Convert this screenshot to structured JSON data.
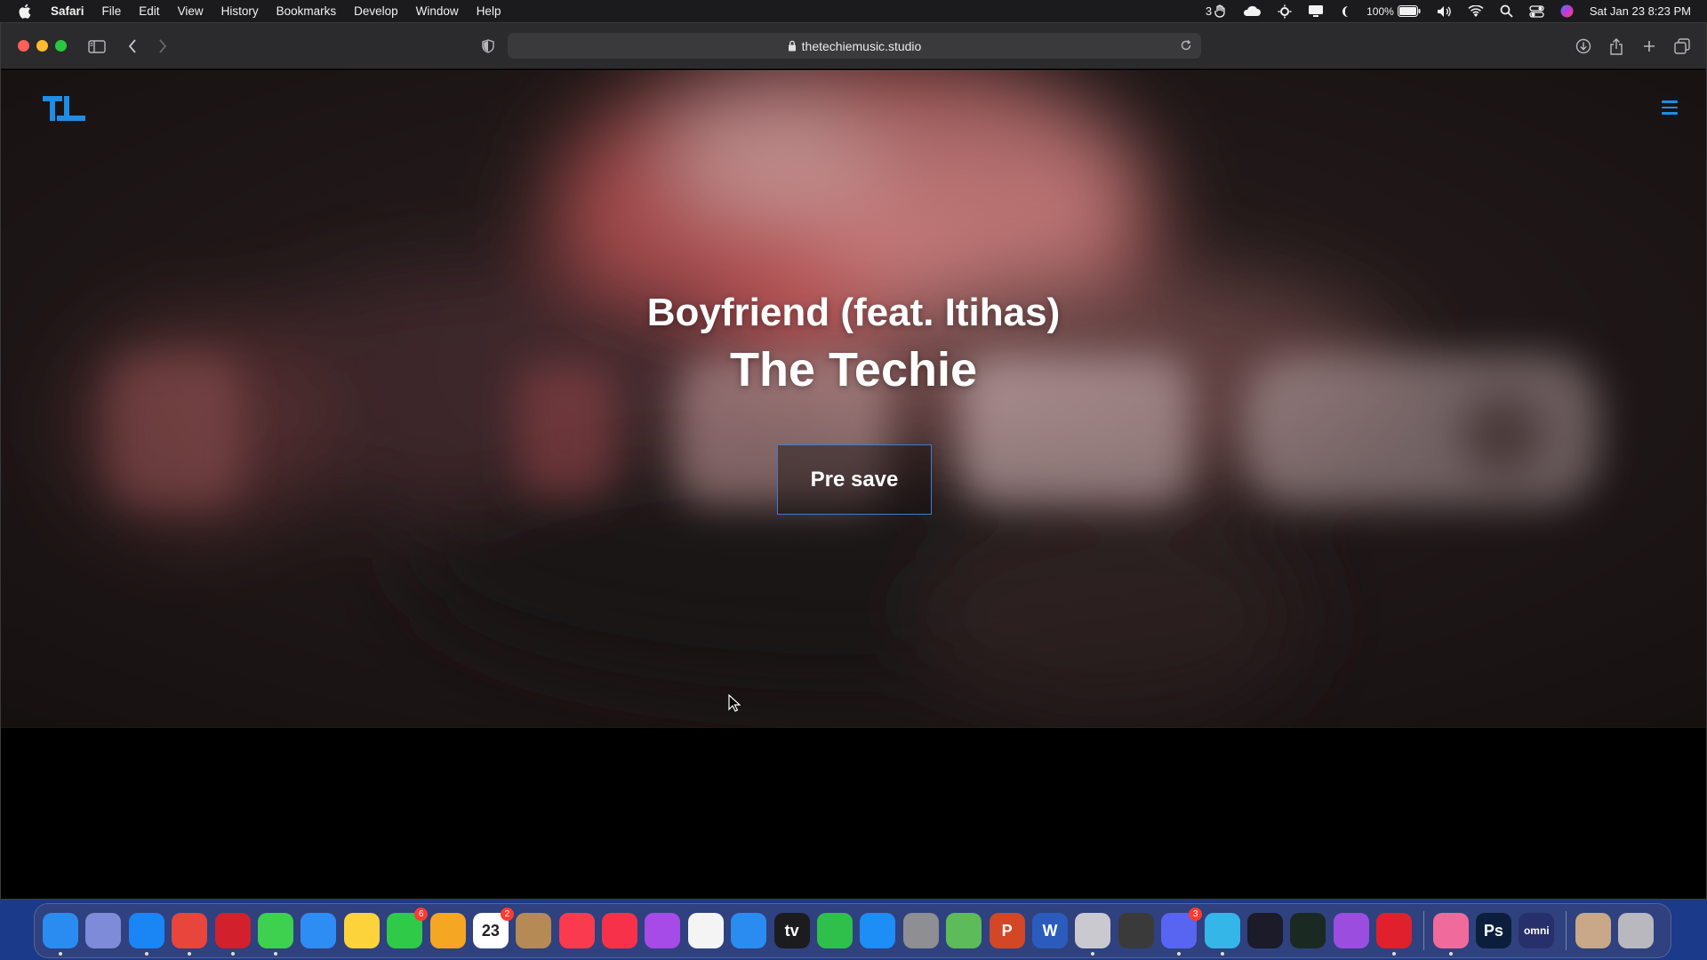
{
  "menubar": {
    "app_name": "Safari",
    "menus": [
      "File",
      "Edit",
      "View",
      "History",
      "Bookmarks",
      "Develop",
      "Window",
      "Help"
    ],
    "status": {
      "notification_count": "3",
      "battery": "100%",
      "datetime": "Sat Jan 23  8:23 PM"
    }
  },
  "browser": {
    "url": "thetechiemusic.studio"
  },
  "page": {
    "logo_text": "TL",
    "song_title": "Boyfriend (feat. Itihas)",
    "artist": "The Techie",
    "presave_label": "Pre save"
  },
  "dock": {
    "apps": [
      {
        "name": "Finder",
        "icon": "finder-icon",
        "color": "#2a8cf0",
        "running": true
      },
      {
        "name": "Launchpad",
        "icon": "launchpad-icon",
        "color": "#7d8bd8",
        "running": false
      },
      {
        "name": "Safari",
        "icon": "safari-icon",
        "color": "#1a85f5",
        "running": true
      },
      {
        "name": "Chrome",
        "icon": "chrome-icon",
        "color": "#e8453c",
        "running": true
      },
      {
        "name": "Opera",
        "icon": "opera-icon",
        "color": "#d2202c",
        "running": true
      },
      {
        "name": "Messages",
        "icon": "messages-icon",
        "color": "#3dd14f",
        "running": true
      },
      {
        "name": "Mail",
        "icon": "mail-icon",
        "color": "#2e8df5",
        "running": false
      },
      {
        "name": "Notes",
        "icon": "notes-icon",
        "color": "#fcd33a",
        "running": false
      },
      {
        "name": "FaceTime",
        "icon": "facetime-icon",
        "color": "#2fca47",
        "running": false,
        "badge": "6"
      },
      {
        "name": "Photos",
        "icon": "photos-icon",
        "color": "#f5a623",
        "running": false
      },
      {
        "name": "Calendar",
        "icon": "calendar-icon",
        "color": "#ffffff",
        "running": false,
        "badge": "2",
        "label": "23"
      },
      {
        "name": "Contacts",
        "icon": "contacts-icon",
        "color": "#b58a55",
        "running": false
      },
      {
        "name": "Music",
        "icon": "music-icon",
        "color": "#fa3a4f",
        "running": false
      },
      {
        "name": "News",
        "icon": "news-icon",
        "color": "#f7314a",
        "running": false
      },
      {
        "name": "Podcasts",
        "icon": "podcasts-icon",
        "color": "#a64ae8",
        "running": false
      },
      {
        "name": "Reminders",
        "icon": "reminders-icon",
        "color": "#f4f4f4",
        "running": false
      },
      {
        "name": "Keynote",
        "icon": "keynote-icon",
        "color": "#2a8cf0",
        "running": false
      },
      {
        "name": "TV",
        "icon": "tv-icon",
        "color": "#1c1c1e",
        "running": false,
        "label": "tv"
      },
      {
        "name": "Numbers",
        "icon": "numbers-icon",
        "color": "#2fbf4b",
        "running": false
      },
      {
        "name": "App Store",
        "icon": "appstore-icon",
        "color": "#1d8ef5",
        "running": false
      },
      {
        "name": "System Preferences",
        "icon": "settings-icon",
        "color": "#8e8e93",
        "running": false
      },
      {
        "name": "Maps",
        "icon": "maps-icon",
        "color": "#5dbb5a",
        "running": false
      },
      {
        "name": "PowerPoint",
        "icon": "powerpoint-icon",
        "color": "#d24726",
        "running": false,
        "label": "P"
      },
      {
        "name": "Word",
        "icon": "word-icon",
        "color": "#2b5cbd",
        "running": false,
        "label": "W"
      },
      {
        "name": "Compressor",
        "icon": "compressor-icon",
        "color": "#c9c9cf",
        "running": true
      },
      {
        "name": "Final Cut Pro",
        "icon": "finalcut-icon",
        "color": "#3a3a3a",
        "running": false
      },
      {
        "name": "Discord",
        "icon": "discord-icon",
        "color": "#5865f2",
        "running": true,
        "badge": "3"
      },
      {
        "name": "Screens",
        "icon": "screens-icon",
        "color": "#35b6e8",
        "running": true
      },
      {
        "name": "Scroll",
        "icon": "scroll-icon",
        "color": "#1b1b2a",
        "running": false
      },
      {
        "name": "Activity Monitor",
        "icon": "activity-monitor-icon",
        "color": "#1a2a22",
        "running": false
      },
      {
        "name": "Feedback",
        "icon": "feedback-icon",
        "color": "#9b4de0",
        "running": false
      },
      {
        "name": "Raise Hand",
        "icon": "hand-icon",
        "color": "#e0202c",
        "running": true
      }
    ],
    "apps_right": [
      {
        "name": "CleanMyMac",
        "icon": "cleanmymac-icon",
        "color": "#f06b9b",
        "running": true
      },
      {
        "name": "Photoshop",
        "icon": "photoshop-icon",
        "color": "#0b1f3d",
        "running": false,
        "label": "Ps"
      },
      {
        "name": "Omni",
        "icon": "omni-icon",
        "color": "#27306a",
        "running": false,
        "label": "omni"
      }
    ],
    "apps_trash": [
      {
        "name": "Downloads",
        "icon": "downloads-folder-icon",
        "color": "#c8a888",
        "running": false
      },
      {
        "name": "Trash",
        "icon": "trash-icon",
        "color": "#b8b8be",
        "running": false
      }
    ]
  }
}
